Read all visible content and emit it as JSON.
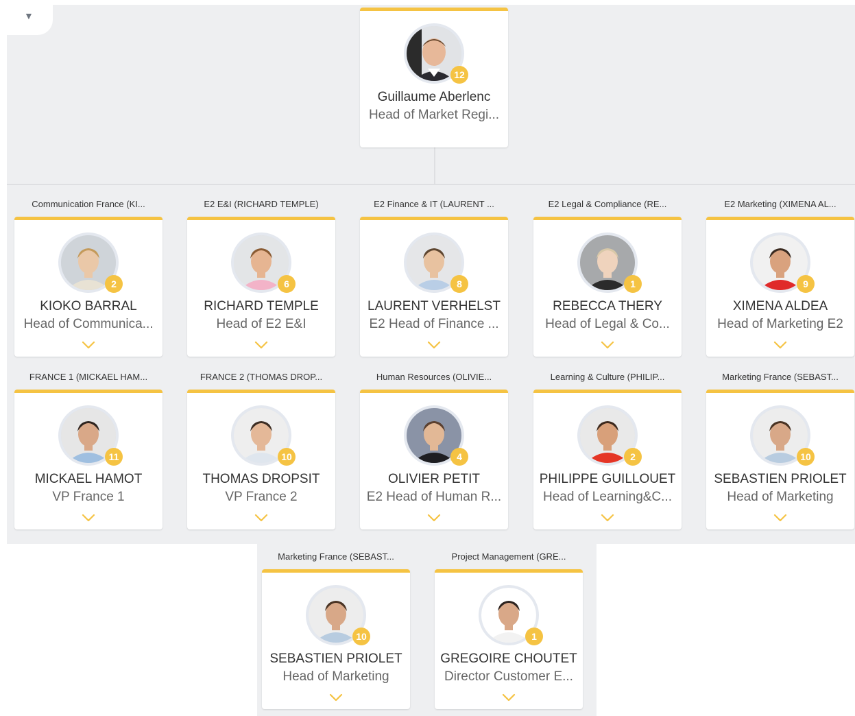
{
  "root": {
    "name": "Guillaume Aberlenc",
    "title": "Head of Market Regi...",
    "reports": "12"
  },
  "collapse_icon": "triangle-down-icon",
  "colors": {
    "accent": "#f5c343",
    "background": "#eeeff1"
  },
  "rows": [
    [
      {
        "dept": "Communication France (KI...",
        "name": "KIOKO BARRAL",
        "title": "Head of Communica...",
        "reports": "2",
        "bg": "#cfd4d9",
        "skin": "#eac8a8",
        "hair": "#c49a5a",
        "shirt": "#e8e2d4"
      },
      {
        "dept": "E2 E&I (RICHARD TEMPLE)",
        "name": "RICHARD TEMPLE",
        "title": "Head of E2 E&I",
        "reports": "6",
        "bg": "#e3e5e7",
        "skin": "#e6b592",
        "hair": "#8a5b33",
        "shirt": "#f3b3c8"
      },
      {
        "dept": "E2 Finance & IT (LAURENT ...",
        "name": "LAURENT VERHELST",
        "title": "E2 Head of Finance ...",
        "reports": "8",
        "bg": "#e5e6e8",
        "skin": "#e8c2a0",
        "hair": "#5e4630",
        "shirt": "#b9cee6"
      },
      {
        "dept": "E2 Legal & Compliance (RE...",
        "name": "REBECCA THERY",
        "title": "Head of Legal & Co...",
        "reports": "1",
        "bg": "#a7a9ab",
        "skin": "#efd3bd",
        "hair": "#d8c8a8",
        "shirt": "#2b2b2b"
      },
      {
        "dept": "E2 Marketing (XIMENA AL...",
        "name": "XIMENA ALDEA",
        "title": "Head of Marketing E2",
        "reports": "9",
        "bg": "#f1f1f1",
        "skin": "#d9a27e",
        "hair": "#3a2a20",
        "shirt": "#e02a2a"
      }
    ],
    [
      {
        "dept": "FRANCE 1 (MICKAEL HAM...",
        "name": "MICKAEL HAMOT",
        "title": "VP France 1",
        "reports": "11",
        "bg": "#e6e6e6",
        "skin": "#d9a888",
        "hair": "#2f2520",
        "shirt": "#9fbfe0"
      },
      {
        "dept": "FRANCE 2 (THOMAS DROP...",
        "name": "THOMAS DROPSIT",
        "title": "VP France 2",
        "reports": "10",
        "bg": "#eeeeee",
        "skin": "#e4b898",
        "hair": "#3d2e24",
        "shirt": "#dfe6ee"
      },
      {
        "dept": "Human Resources (OLIVIE...",
        "name": "OLIVIER PETIT",
        "title": "E2 Head of Human R...",
        "reports": "4",
        "bg": "#8a93a6",
        "skin": "#e2b896",
        "hair": "#5a4030",
        "shirt": "#1e1e22"
      },
      {
        "dept": "Learning & Culture (PHILIP...",
        "name": "PHILIPPE GUILLOUET",
        "title": "Head of Learning&C...",
        "reports": "2",
        "bg": "#e9e9e9",
        "skin": "#d8a07a",
        "hair": "#3d2a1e",
        "shirt": "#e53525"
      },
      {
        "dept": "Marketing France (SEBAST...",
        "name": "SEBASTIEN PRIOLET",
        "title": "Head of Marketing",
        "reports": "10",
        "bg": "#ededed",
        "skin": "#d8a888",
        "hair": "#4a3424",
        "shirt": "#b8cce0"
      }
    ],
    [
      {
        "dept": "Marketing France (SEBAST...",
        "name": "SEBASTIEN PRIOLET",
        "title": "Head of Marketing",
        "reports": "10",
        "bg": "#ededed",
        "skin": "#d8a888",
        "hair": "#4a3424",
        "shirt": "#b8cce0"
      },
      {
        "dept": "Project Management (GRE...",
        "name": "GREGOIRE CHOUTET",
        "title": "Director Customer E...",
        "reports": "1",
        "bg": "#ffffff",
        "skin": "#d9a888",
        "hair": "#2e2420",
        "shirt": "#f2f2f2"
      }
    ]
  ]
}
